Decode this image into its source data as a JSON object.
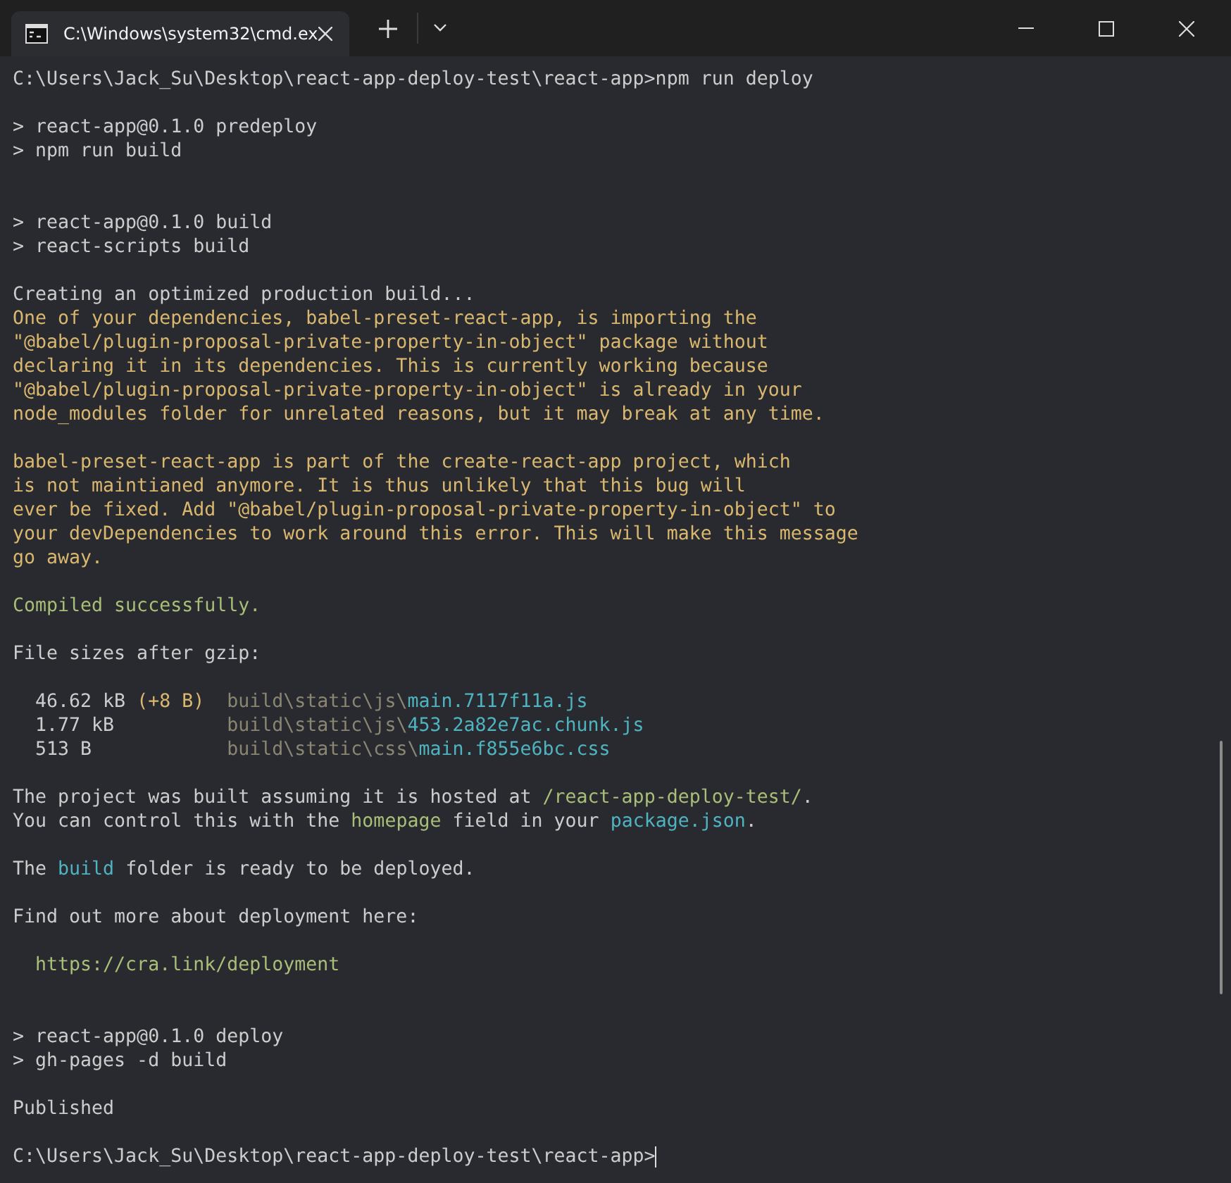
{
  "window": {
    "tab": {
      "title": "C:\\Windows\\system32\\cmd.ex",
      "selected": true
    }
  },
  "terminal": {
    "lines": [
      {
        "kind": "text",
        "spans": [
          {
            "text": "C:\\Users\\Jack_Su\\Desktop\\react-app-deploy-test\\react-app>npm run deploy",
            "color": "#cccccc"
          }
        ]
      },
      {
        "kind": "blank"
      },
      {
        "kind": "text",
        "spans": [
          {
            "text": "> react-app@0.1.0 predeploy",
            "color": "#cccccc"
          }
        ]
      },
      {
        "kind": "text",
        "spans": [
          {
            "text": "> npm run build",
            "color": "#cccccc"
          }
        ]
      },
      {
        "kind": "blank"
      },
      {
        "kind": "blank"
      },
      {
        "kind": "text",
        "spans": [
          {
            "text": "> react-app@0.1.0 build",
            "color": "#cccccc"
          }
        ]
      },
      {
        "kind": "text",
        "spans": [
          {
            "text": "> react-scripts build",
            "color": "#cccccc"
          }
        ]
      },
      {
        "kind": "blank"
      },
      {
        "kind": "text",
        "spans": [
          {
            "text": "Creating an optimized production build...",
            "color": "#cccccc"
          }
        ]
      },
      {
        "kind": "text",
        "spans": [
          {
            "text": "One of your dependencies, babel-preset-react-app, is importing the",
            "color": "#d9b76e"
          }
        ]
      },
      {
        "kind": "text",
        "spans": [
          {
            "text": "\"@babel/plugin-proposal-private-property-in-object\" package without",
            "color": "#d9b76e"
          }
        ]
      },
      {
        "kind": "text",
        "spans": [
          {
            "text": "declaring it in its dependencies. This is currently working because",
            "color": "#d9b76e"
          }
        ]
      },
      {
        "kind": "text",
        "spans": [
          {
            "text": "\"@babel/plugin-proposal-private-property-in-object\" is already in your",
            "color": "#d9b76e"
          }
        ]
      },
      {
        "kind": "text",
        "spans": [
          {
            "text": "node_modules folder for unrelated reasons, but it may break at any time.",
            "color": "#d9b76e"
          }
        ]
      },
      {
        "kind": "blank"
      },
      {
        "kind": "text",
        "spans": [
          {
            "text": "babel-preset-react-app is part of the create-react-app project, which",
            "color": "#d9b76e"
          }
        ]
      },
      {
        "kind": "text",
        "spans": [
          {
            "text": "is not maintianed anymore. It is thus unlikely that this bug will",
            "color": "#d9b76e"
          }
        ]
      },
      {
        "kind": "text",
        "spans": [
          {
            "text": "ever be fixed. Add \"@babel/plugin-proposal-private-property-in-object\" to",
            "color": "#d9b76e"
          }
        ]
      },
      {
        "kind": "text",
        "spans": [
          {
            "text": "your devDependencies to work around this error. This will make this message",
            "color": "#d9b76e"
          }
        ]
      },
      {
        "kind": "text",
        "spans": [
          {
            "text": "go away.",
            "color": "#d9b76e"
          }
        ]
      },
      {
        "kind": "blank"
      },
      {
        "kind": "text",
        "spans": [
          {
            "text": "Compiled successfully.",
            "color": "#a9be77"
          }
        ]
      },
      {
        "kind": "blank"
      },
      {
        "kind": "text",
        "spans": [
          {
            "text": "File sizes after gzip:",
            "color": "#cccccc"
          }
        ]
      },
      {
        "kind": "blank"
      },
      {
        "kind": "text",
        "spans": [
          {
            "text": "  46.62 kB ",
            "color": "#cccccc"
          },
          {
            "text": "(+8 B)",
            "color": "#d9b76e"
          },
          {
            "text": "  build\\static\\js\\",
            "color": "#8b8672"
          },
          {
            "text": "main.7117f11a.js",
            "color": "#4fb3c0"
          }
        ]
      },
      {
        "kind": "text",
        "spans": [
          {
            "text": "  1.77 kB",
            "color": "#cccccc"
          },
          {
            "text": "          build\\static\\js\\",
            "color": "#8b8672"
          },
          {
            "text": "453.2a82e7ac.chunk.js",
            "color": "#4fb3c0"
          }
        ]
      },
      {
        "kind": "text",
        "spans": [
          {
            "text": "  513 B",
            "color": "#cccccc"
          },
          {
            "text": "            build\\static\\css\\",
            "color": "#8b8672"
          },
          {
            "text": "main.f855e6bc.css",
            "color": "#4fb3c0"
          }
        ]
      },
      {
        "kind": "blank"
      },
      {
        "kind": "text",
        "spans": [
          {
            "text": "The project was built assuming it is hosted at ",
            "color": "#cccccc"
          },
          {
            "text": "/react-app-deploy-test/",
            "color": "#a9be77"
          },
          {
            "text": ".",
            "color": "#cccccc"
          }
        ]
      },
      {
        "kind": "text",
        "spans": [
          {
            "text": "You can control this with the ",
            "color": "#cccccc"
          },
          {
            "text": "homepage",
            "color": "#a9be77"
          },
          {
            "text": " field in your ",
            "color": "#cccccc"
          },
          {
            "text": "package.json",
            "color": "#4fb3c0"
          },
          {
            "text": ".",
            "color": "#cccccc"
          }
        ]
      },
      {
        "kind": "blank"
      },
      {
        "kind": "text",
        "spans": [
          {
            "text": "The ",
            "color": "#cccccc"
          },
          {
            "text": "build",
            "color": "#4fb3c0"
          },
          {
            "text": " folder is ready to be deployed.",
            "color": "#cccccc"
          }
        ]
      },
      {
        "kind": "blank"
      },
      {
        "kind": "text",
        "spans": [
          {
            "text": "Find out more about deployment here:",
            "color": "#cccccc"
          }
        ]
      },
      {
        "kind": "blank"
      },
      {
        "kind": "text",
        "spans": [
          {
            "text": "  https://cra.link/deployment",
            "color": "#a9be77"
          }
        ]
      },
      {
        "kind": "blank"
      },
      {
        "kind": "blank"
      },
      {
        "kind": "text",
        "spans": [
          {
            "text": "> react-app@0.1.0 deploy",
            "color": "#cccccc"
          }
        ]
      },
      {
        "kind": "text",
        "spans": [
          {
            "text": "> gh-pages -d build",
            "color": "#cccccc"
          }
        ]
      },
      {
        "kind": "blank"
      },
      {
        "kind": "text",
        "spans": [
          {
            "text": "Published",
            "color": "#cccccc"
          }
        ]
      },
      {
        "kind": "blank"
      },
      {
        "kind": "prompt",
        "spans": [
          {
            "text": "C:\\Users\\Jack_Su\\Desktop\\react-app-deploy-test\\react-app>",
            "color": "#cccccc"
          }
        ]
      }
    ]
  }
}
